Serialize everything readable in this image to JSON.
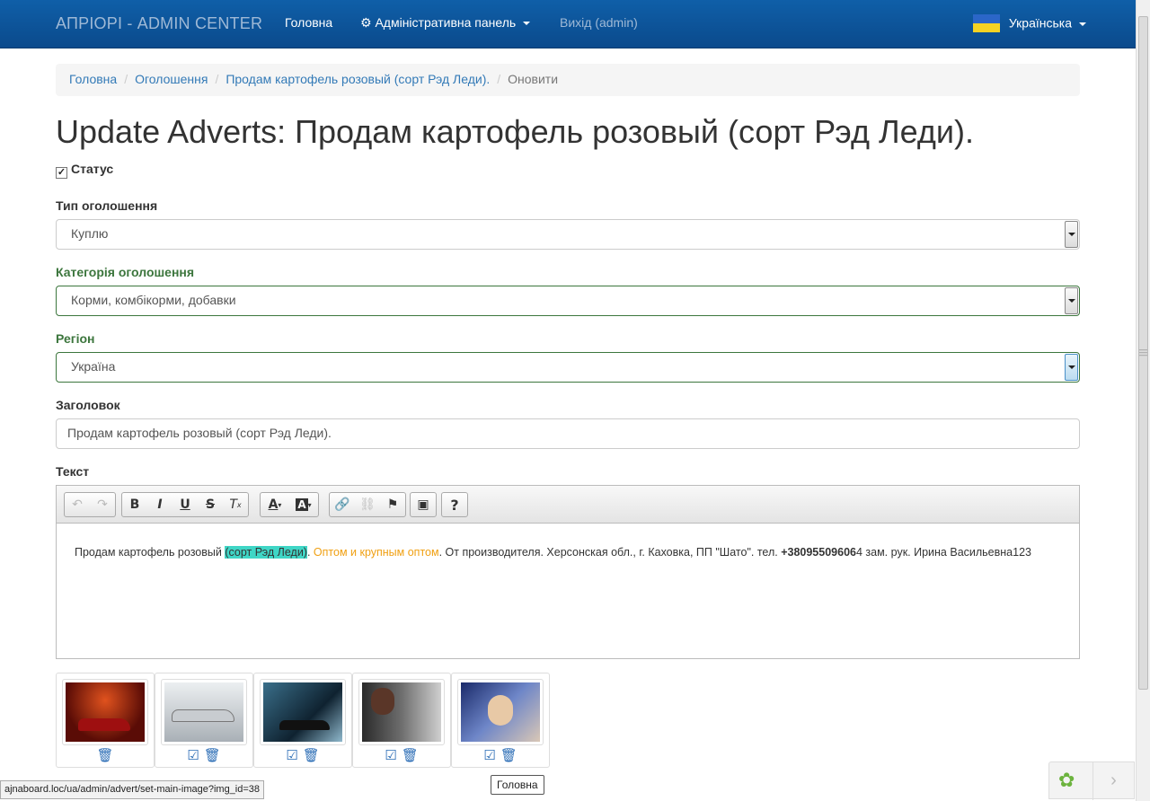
{
  "navbar": {
    "brand": "АПРІОРІ - ADMIN CENTER",
    "home": "Головна",
    "admin_panel": "Адміністративна панель",
    "logout": "Вихід (admin)",
    "language": "Українська"
  },
  "breadcrumb": {
    "items": [
      "Головна",
      "Оголошення",
      "Продам картофель розовый (сорт Рэд Леди)."
    ],
    "active": "Оновити"
  },
  "page_title": "Update Adverts: Продам картофель розовый (сорт Рэд Леди).",
  "form": {
    "status_label": "Статус",
    "status_checked": true,
    "type_label": "Тип оголошення",
    "type_value": "Куплю",
    "category_label": "Категорія оголошення",
    "category_value": "Корми, комбікорми, добавки",
    "region_label": "Регіон",
    "region_value": "Україна",
    "title_label": "Заголовок",
    "title_value": "Продам картофель розовый (сорт Рэд Леди).",
    "text_label": "Текст"
  },
  "editor": {
    "content": {
      "p1": "Продам картофель розовый ",
      "highlight": "(сорт Рэд Леди)",
      "p2": ". ",
      "orange": "Оптом и крупным оптом",
      "p3": ". От производителя. Херсонская обл., г. Каховка, ПП \"Шато\". тел. ",
      "phone": "+38095509606",
      "p4": "4 зам. рук. Ирина Васильевна123"
    },
    "toolbar": {
      "bold": "B",
      "italic": "I",
      "underline": "U",
      "strike": "S",
      "clear": "T",
      "text_color": "A",
      "bg_color": "A",
      "help": "?"
    },
    "colors": {
      "highlight": "#3fd6c6",
      "orange": "#f0a013"
    }
  },
  "images": [
    {
      "name": "red-sports-car",
      "main": true
    },
    {
      "name": "silver-cars",
      "main": false
    },
    {
      "name": "acura-car",
      "main": false
    },
    {
      "name": "woman-photo",
      "main": false
    },
    {
      "name": "vanilla-sky",
      "main": false
    }
  ],
  "statusbar_url": "ajnaboard.loc/ua/admin/advert/set-main-image?img_id=38",
  "tooltip": "Головна"
}
